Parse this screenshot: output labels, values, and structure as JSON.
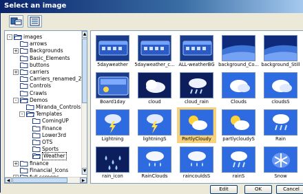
{
  "dialog": {
    "title": "Select an image"
  },
  "toolbar": {
    "left_icon": "folder-view-icon",
    "right_icon": "details-view-icon"
  },
  "tree": [
    {
      "label": "images",
      "level": 0,
      "expander": "-",
      "open": true
    },
    {
      "label": "arrows",
      "level": 1,
      "expander": "",
      "open": false
    },
    {
      "label": "Backgrounds",
      "level": 1,
      "expander": "+",
      "open": false
    },
    {
      "label": "Basic_Elements",
      "level": 1,
      "expander": "",
      "open": false
    },
    {
      "label": "buttons",
      "level": 1,
      "expander": "",
      "open": false
    },
    {
      "label": "carriers",
      "level": 1,
      "expander": "+",
      "open": false
    },
    {
      "label": "Carriers_renamed_2",
      "level": 1,
      "expander": "",
      "open": false
    },
    {
      "label": "Controls",
      "level": 1,
      "expander": "",
      "open": false
    },
    {
      "label": "Crawls",
      "level": 1,
      "expander": "",
      "open": false
    },
    {
      "label": "Demos",
      "level": 1,
      "expander": "-",
      "open": true
    },
    {
      "label": "Miranda_Controls",
      "level": 2,
      "expander": "",
      "open": false
    },
    {
      "label": "Templates",
      "level": 2,
      "expander": "-",
      "open": true
    },
    {
      "label": "ComingUP",
      "level": 3,
      "expander": "",
      "open": false
    },
    {
      "label": "Finance",
      "level": 3,
      "expander": "",
      "open": false
    },
    {
      "label": "Lower3rd",
      "level": 3,
      "expander": "",
      "open": false
    },
    {
      "label": "OTS",
      "level": 3,
      "expander": "",
      "open": false
    },
    {
      "label": "Sports",
      "level": 3,
      "expander": "",
      "open": false
    },
    {
      "label": "Weather",
      "level": 3,
      "expander": "",
      "open": true,
      "selected": true
    },
    {
      "label": "finance",
      "level": 1,
      "expander": "+",
      "open": false
    },
    {
      "label": "Financial_Icons",
      "level": 1,
      "expander": "",
      "open": false
    },
    {
      "label": "full screens",
      "level": 1,
      "expander": "+",
      "open": false
    }
  ],
  "images": [
    {
      "label": "5dayweather",
      "kind": "bar"
    },
    {
      "label": "5dayweather_c...",
      "kind": "bar"
    },
    {
      "label": "ALL-weatherBG",
      "kind": "bar"
    },
    {
      "label": "background_Co...",
      "kind": "sky"
    },
    {
      "label": "background_Still",
      "kind": "sky"
    },
    {
      "label": "Board1day",
      "kind": "board"
    },
    {
      "label": "cloud",
      "kind": "cloud"
    },
    {
      "label": "cloud_rain",
      "kind": "cloudrain"
    },
    {
      "label": "Clouds",
      "kind": "clouds"
    },
    {
      "label": "cloudsS",
      "kind": "clouds"
    },
    {
      "label": "Lightning",
      "kind": "bolt"
    },
    {
      "label": "lightningS",
      "kind": "bolt"
    },
    {
      "label": "PartlyCloudy",
      "kind": "partly",
      "selected": true
    },
    {
      "label": "partlycloudyS",
      "kind": "partly"
    },
    {
      "label": "Rain",
      "kind": "rain"
    },
    {
      "label": "rain_icon",
      "kind": "drops"
    },
    {
      "label": "RainClouds",
      "kind": "raincloud"
    },
    {
      "label": "raincouldsS",
      "kind": "raincloud"
    },
    {
      "label": "rainS",
      "kind": "rain"
    },
    {
      "label": "Snow",
      "kind": "snow"
    }
  ],
  "buttons": {
    "edit": "Edit",
    "ok": "OK",
    "cancel": "Cancel"
  }
}
